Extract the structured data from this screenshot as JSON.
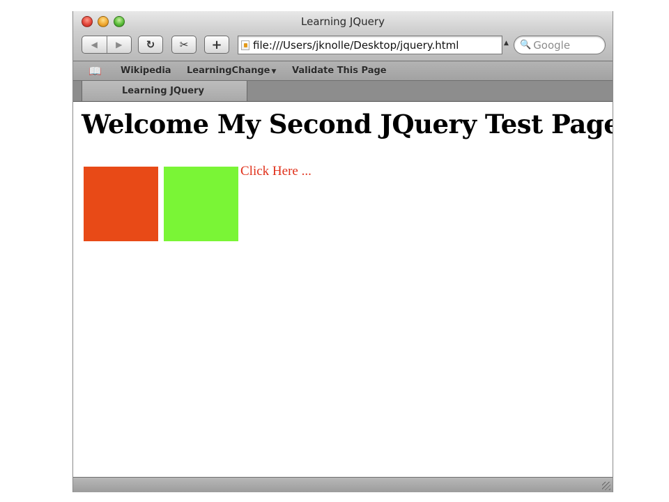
{
  "window": {
    "title": "Learning JQuery"
  },
  "toolbar": {
    "back_icon": "◀",
    "forward_icon": "▶",
    "reload_icon": "↻",
    "snip_icon": "✂",
    "add_icon": "+",
    "address": "file:///Users/jknolle/Desktop/jquery.html",
    "address_menu_icon": "▲",
    "search_icon": "🔍",
    "search_placeholder": "Google"
  },
  "bookmarks": {
    "book_icon": "📖",
    "items": [
      {
        "label": "Wikipedia"
      },
      {
        "label": "LearningChange"
      },
      {
        "label": "Validate This Page"
      }
    ],
    "dropdown_icon": "▼"
  },
  "tabs": [
    {
      "label": "Learning JQuery",
      "active": true
    }
  ],
  "page": {
    "heading": "Welcome My Second JQuery Test Page",
    "boxes": [
      {
        "color": "#e84a17"
      },
      {
        "color": "#7af536"
      }
    ],
    "link": {
      "text": "Click Here ...",
      "color": "#e0301a"
    }
  }
}
